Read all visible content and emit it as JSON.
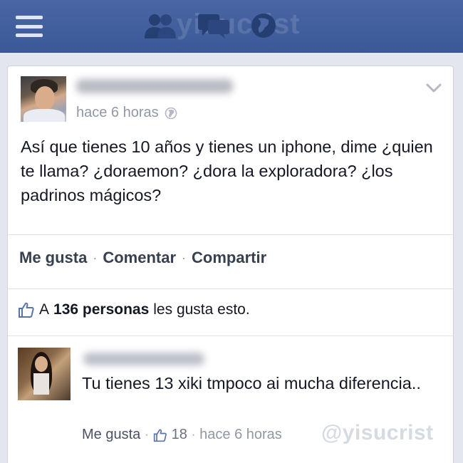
{
  "topbar": {
    "watermark": "yisucrist",
    "icons": [
      "menu-icon",
      "friends-icon",
      "messages-icon",
      "globe-icon"
    ],
    "color": "#3b5998"
  },
  "post": {
    "time": "hace 6 horas",
    "text": "Así que tienes 10 años y tienes un iphone, dime ¿quien te llama? ¿doraemon? ¿dora la exploradora? ¿los padrinos mágicos?",
    "actions": {
      "like": "Me gusta",
      "comment": "Comentar",
      "share": "Compartir"
    },
    "likes": {
      "prefix": "A",
      "count": "136 personas",
      "suffix": "les gusta esto."
    }
  },
  "comment": {
    "text": "Tu tienes 13 xiki tmpoco ai mucha diferencia..",
    "like_label": "Me gusta",
    "like_count": "18",
    "time": "hace 6 horas"
  },
  "watermark_bottom": "@yisucrist"
}
